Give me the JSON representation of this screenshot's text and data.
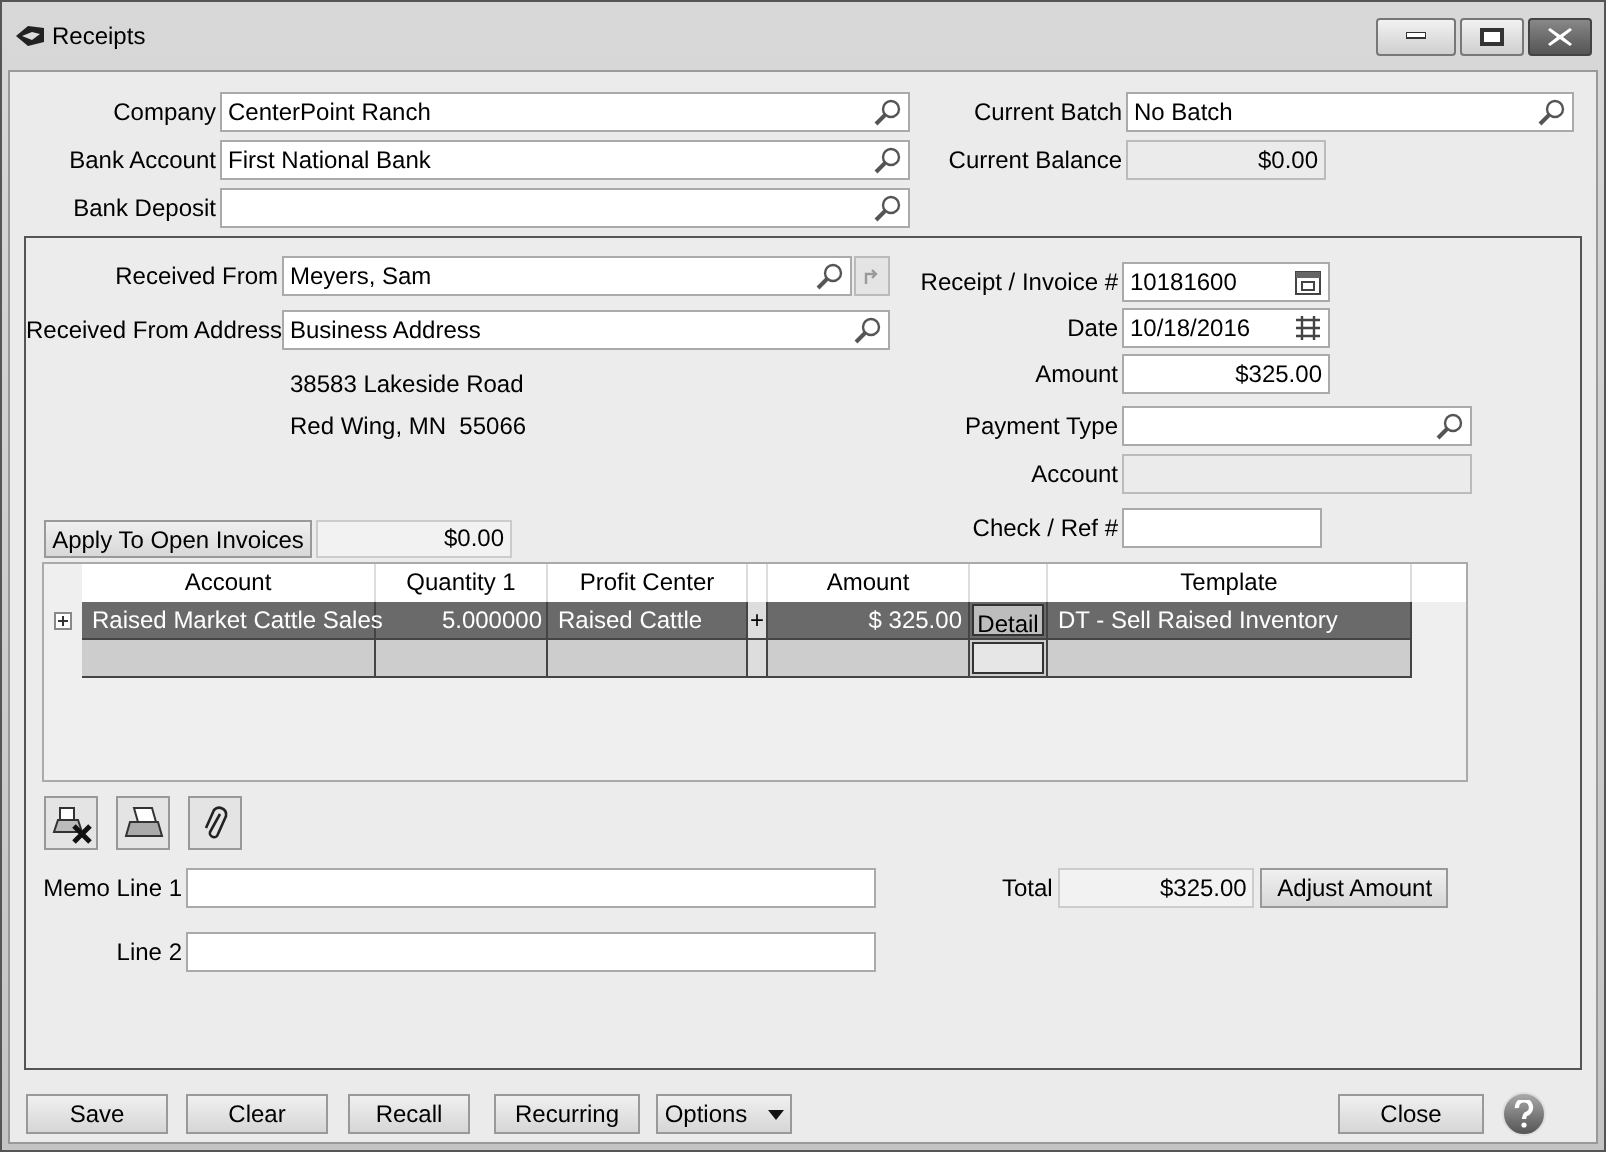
{
  "window": {
    "title": "Receipts"
  },
  "header_left": [
    {
      "label": "Company",
      "value": "CenterPoint Ranch",
      "kind": "lookup"
    },
    {
      "label": "Bank Account",
      "value": "First National Bank",
      "kind": "lookup"
    },
    {
      "label": "Bank Deposit",
      "kind": "lookup"
    }
  ],
  "header_right": [
    {
      "label": "Current Batch",
      "value": "No Batch",
      "kind": "lookup"
    },
    {
      "label": "Current Balance",
      "value": "$0.00",
      "kind": "readonly"
    }
  ],
  "received_from": {
    "label": "Received From",
    "value": "Meyers, Sam"
  },
  "received_from_address": {
    "label": "Received From Address",
    "value": "Business Address"
  },
  "address_lines": [
    "38583 Lakeside Road",
    "Red Wing, MN  55066"
  ],
  "receipt_fields": [
    {
      "label": "Receipt / Invoice #",
      "value": "10181600",
      "kind": "calendar"
    },
    {
      "label": "Date",
      "value": "10/18/2016",
      "kind": "date"
    },
    {
      "label": "Amount",
      "value": "$325.00",
      "kind": "money"
    },
    {
      "label": "Payment Type",
      "kind": "lookup"
    },
    {
      "label": "Account",
      "kind": "readonly"
    },
    {
      "label": "Check / Ref #",
      "kind": "text"
    }
  ],
  "apply_button": {
    "label": "Apply To Open Invoices",
    "amount": "$0.00"
  },
  "grid": {
    "columns": [
      {
        "label": "Account"
      },
      {
        "label": "Quantity 1"
      },
      {
        "label": "Profit Center"
      },
      {},
      {
        "label": "Amount"
      },
      {},
      {
        "label": "Template"
      }
    ],
    "rows": [
      {
        "selected": true,
        "cells": [
          "Raised Market Cattle Sales",
          "5.000000",
          "Raised Cattle",
          "+",
          "$ 325.00",
          "Detail",
          "DT - Sell Raised Inventory"
        ]
      },
      {
        "selected": false
      }
    ]
  },
  "memo": [
    {
      "label": "Memo Line 1"
    },
    {
      "label": "Line 2"
    }
  ],
  "total": {
    "label": "Total",
    "value": "$325.00",
    "button": "Adjust Amount"
  },
  "buttons": [
    {
      "label": "Save",
      "kind": "plain"
    },
    {
      "label": "Clear",
      "kind": "plain"
    },
    {
      "label": "Recall",
      "kind": "plain"
    },
    {
      "label": "Recurring",
      "kind": "plain"
    },
    {
      "label": "Options",
      "kind": "dropdown"
    },
    {
      "label": "Close",
      "kind": "close"
    }
  ]
}
